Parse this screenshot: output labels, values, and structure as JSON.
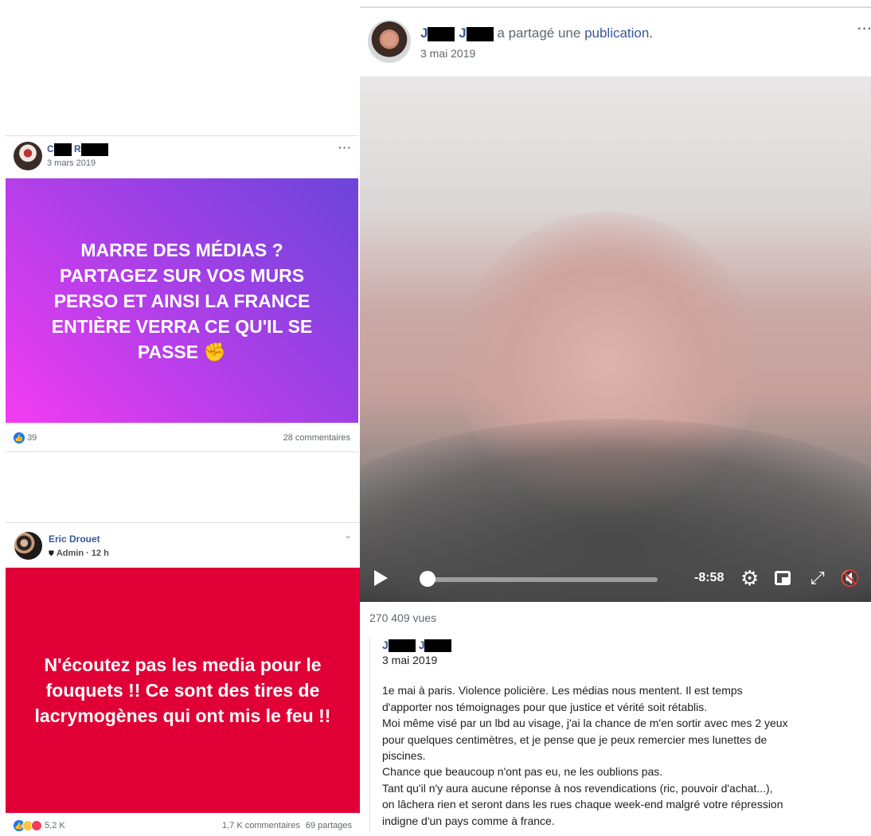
{
  "post_left_top": {
    "name_initials": [
      "C",
      "R"
    ],
    "date": "3 mars 2019",
    "message": "MARRE DES MÉDIAS ? PARTAGEZ SUR VOS MURS PERSO ET AINSI LA FRANCE ENTIÈRE VERRA CE QU'IL SE PASSE ✊",
    "reactions_count": "39",
    "comments": "28 commentaires",
    "menu": "···",
    "colors": {
      "gradient_start": "#f43bf1",
      "gradient_end": "#6b44db"
    }
  },
  "post_left_bottom": {
    "name": "Eric Drouet",
    "role": "Admin · 12 h",
    "message": "N'écoutez pas les media pour le fouquets !! Ce sont des tires de lacrymogènes qui ont mis le feu !!",
    "reactions_count": "5,2 K",
    "comments": "1,7 K commentaires",
    "shares": "69 partages",
    "background_color": "#e00036"
  },
  "post_right": {
    "name_initials": [
      "J",
      "J"
    ],
    "shared_text": "a partagé une",
    "shared_link": "publication.",
    "date": "3 mai 2019",
    "menu": "···",
    "video": {
      "time_remaining": "-8:58",
      "progress": 0.0
    },
    "views": "270 409 vues",
    "quoted": {
      "name_initials": [
        "J",
        "J"
      ],
      "date": "3 mai 2019",
      "lines": [
        "1e mai à paris. Violence policière. Les médias nous mentent. Il est temps",
        "d'apporter nos témoignages pour que justice et vérité soit rétablis.",
        "Moi même visé par un lbd au visage, j'ai la chance de m'en sortir avec mes 2 yeux",
        "pour quelques centimètres, et je pense que je peux remercier mes lunettes de",
        "piscines.",
        "Chance que beaucoup n'ont pas eu, ne les oublions pas.",
        "Tant qu'il n'y aura aucune réponse à nos revendications (ric, pouvoir d'achat...),",
        "on lâchera rien et seront dans les rues chaque week-end malgré votre répression",
        "indigne d'un pays comme à france."
      ]
    }
  }
}
